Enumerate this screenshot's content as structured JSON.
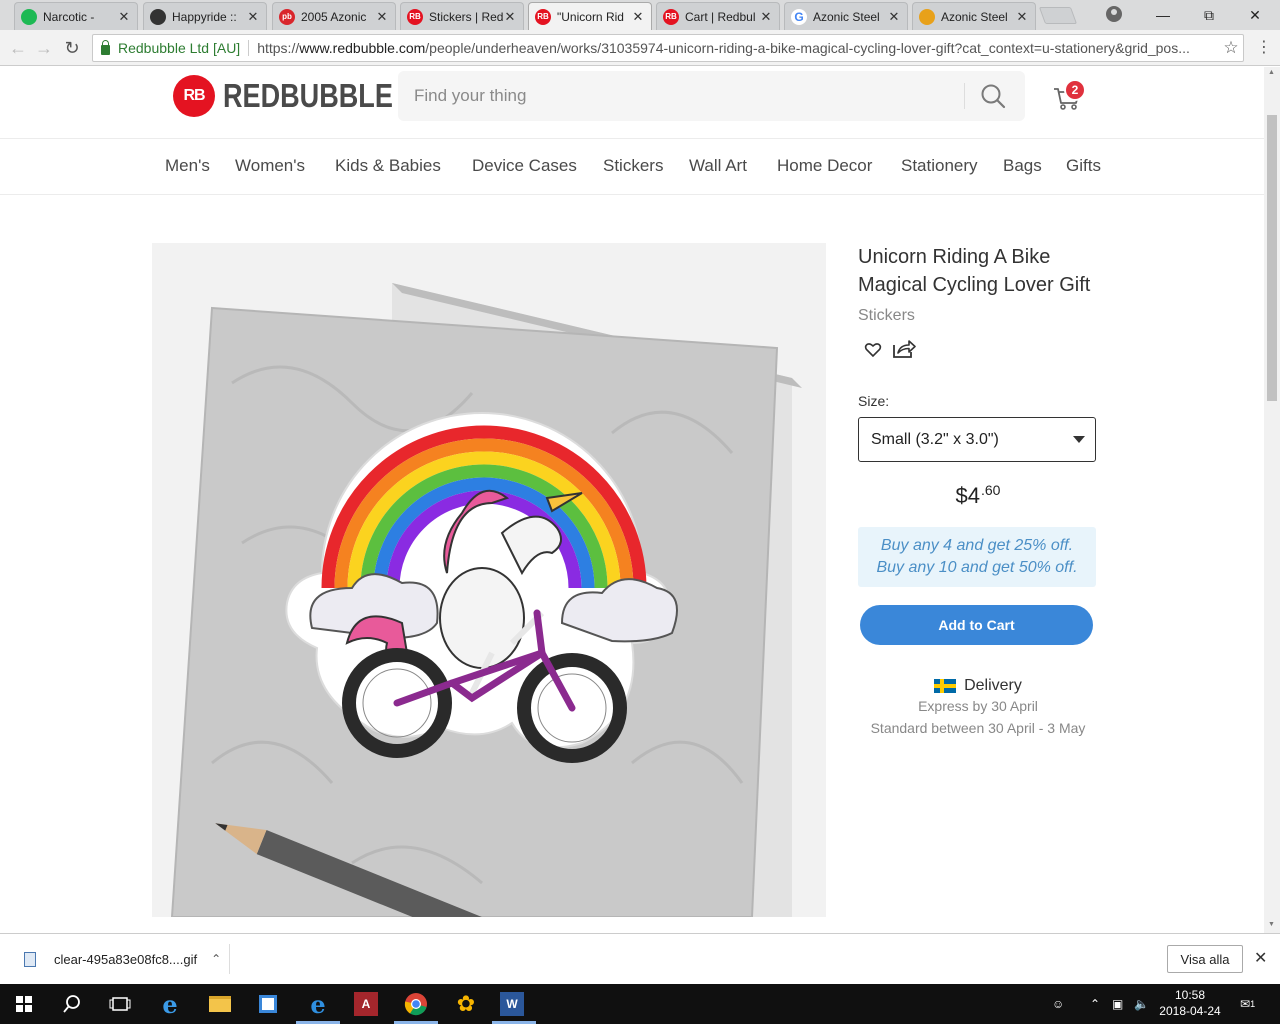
{
  "browser": {
    "tabs": [
      {
        "label": "Narcotic -",
        "fav_color": "#1db954",
        "fav_text": ""
      },
      {
        "label": "Happyride ::",
        "fav_color": "#333333",
        "fav_text": ""
      },
      {
        "label": "2005 Azonic",
        "fav_color": "#d9262c",
        "fav_text": "pb"
      },
      {
        "label": "Stickers | Red",
        "fav_color": "#e41321",
        "fav_text": "RB"
      },
      {
        "label": "\"Unicorn Rid",
        "fav_color": "#e41321",
        "fav_text": "RB"
      },
      {
        "label": "Cart | Redbul",
        "fav_color": "#e41321",
        "fav_text": "RB"
      },
      {
        "label": "Azonic Steel",
        "fav_color": "#ffffff",
        "fav_text": "G"
      },
      {
        "label": "Azonic Steel",
        "fav_color": "#e8a11a",
        "fav_text": ""
      }
    ],
    "secure_label": "Redbubble Ltd [AU]",
    "url_prefix": "https://",
    "url_host": "www.redbubble.com",
    "url_path": "/people/underheaven/works/31035974-unicorn-riding-a-bike-magical-cycling-lover-gift?cat_context=u-stationery&grid_pos..."
  },
  "site": {
    "logo_mark": "RB",
    "logo_text": "REDBUBBLE",
    "search_placeholder": "Find your thing",
    "cart_count": "2",
    "nav": [
      "Men's",
      "Women's",
      "Kids & Babies",
      "Device Cases",
      "Stickers",
      "Wall Art",
      "Home Decor",
      "Stationery",
      "Bags",
      "Gifts"
    ]
  },
  "product": {
    "title": "Unicorn Riding A Bike Magical Cycling Lover Gift",
    "category": "Stickers",
    "size_label": "Size:",
    "size_value": "Small (3.2\" x 3.0\")",
    "price_main": "$4",
    "price_cents": ".60",
    "promo_line1": "Buy any 4 and get 25% off.",
    "promo_line2": "Buy any 10 and get 50% off.",
    "add_to_cart": "Add to Cart",
    "delivery_title": "Delivery",
    "delivery_express": "Express by 30 April",
    "delivery_standard": "Standard between 30 April - 3 May"
  },
  "downloads": {
    "file_name": "clear-495a83e08fc8....gif",
    "show_all": "Visa alla"
  },
  "taskbar": {
    "time": "10:58",
    "date": "2018-04-24",
    "notifications": "1"
  },
  "colors": {
    "brand_red": "#e41321",
    "button_blue": "#3a87d9",
    "promo_text": "#4b8fc6",
    "promo_bg": "#e8f4fb"
  }
}
